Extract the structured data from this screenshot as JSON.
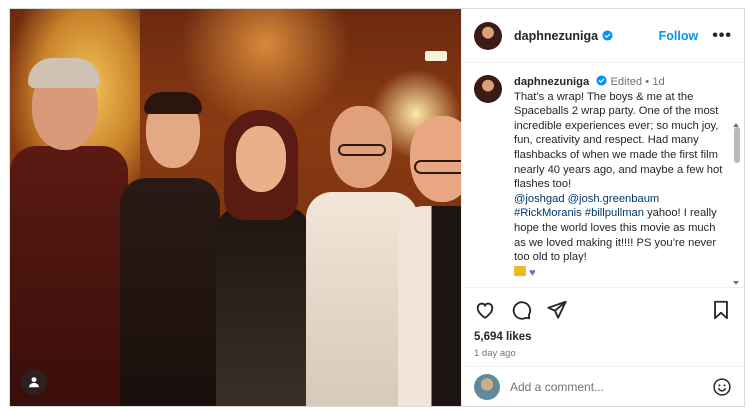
{
  "post": {
    "author": "daphnezuniga",
    "follow_label": "Follow",
    "more_label": "•••",
    "caption": {
      "username": "daphnezuniga",
      "edited": "Edited",
      "sep": "•",
      "time": "1d",
      "text_1": "That’s a wrap! The boys & me at the Spaceballs 2 wrap party. One of the most incredible experiences ever; so much joy, fun, creativity and respect. Had many flashbacks of when we made the first film nearly 40 years ago, and maybe a few hot flashes too!",
      "tag_1": "@joshgad",
      "tag_2": "@josh.greenbaum",
      "tag_3": "#RickMoranis",
      "tag_4": "#billpullman",
      "text_2": " yahoo! I really hope the world loves this movie as much as we loved making it!!!! PS you’re never too old to play!"
    },
    "likes": "5,694 likes",
    "time_ago": "1 day ago",
    "comment_placeholder": "Add a comment..."
  },
  "icons": {
    "verified": "verified-badge-icon",
    "heart": "heart-icon",
    "comment": "comment-icon",
    "share": "share-icon",
    "bookmark": "bookmark-icon",
    "emoji": "emoji-icon",
    "user_tag": "tagged-users-icon"
  },
  "colors": {
    "link": "#0095f6",
    "tag": "#00376b",
    "verified": "#0095f6",
    "muted": "#737373"
  }
}
